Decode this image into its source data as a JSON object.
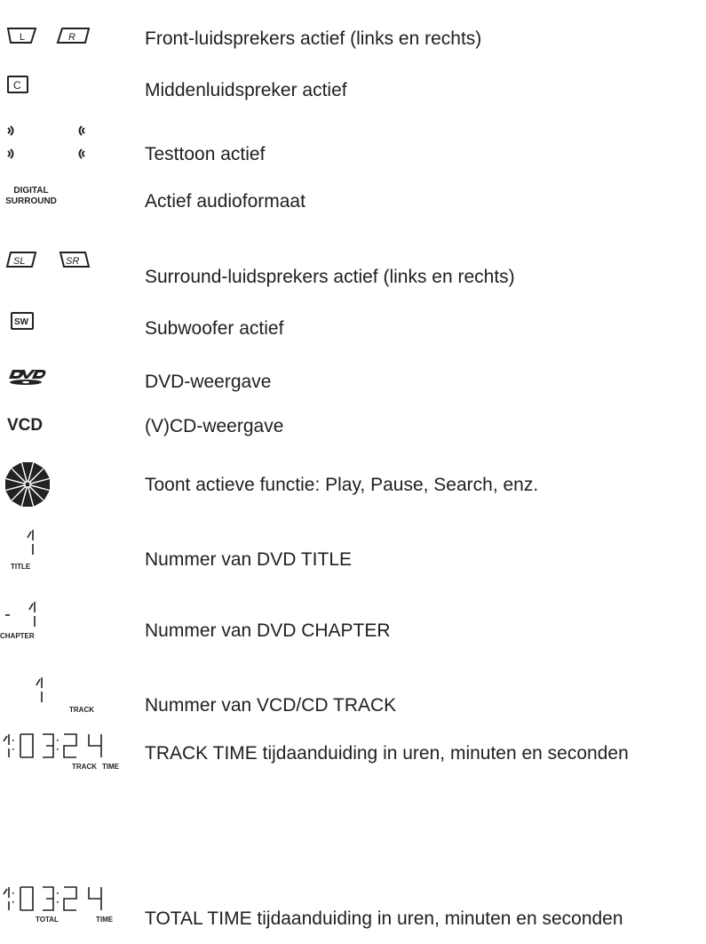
{
  "rows": [
    {
      "icon": "front-speakers-icon",
      "labels": [
        "L",
        "R"
      ],
      "text": "Front-luidsprekers actief (links en rechts)"
    },
    {
      "icon": "center-speaker-icon",
      "labels": [
        "C"
      ],
      "text": "Middenluidspreker actief"
    },
    {
      "icon": "test-tone-icon",
      "text": "Testtoon actief"
    },
    {
      "icon": "digital-surround-icon",
      "labels": [
        "DIGITAL",
        "SURROUND"
      ],
      "text": "Actief audioformaat"
    },
    {
      "icon": "surround-speakers-icon",
      "labels": [
        "SL",
        "SR"
      ],
      "text": "Surround-luidsprekers actief (links en rechts)"
    },
    {
      "icon": "subwoofer-icon",
      "labels": [
        "SW"
      ],
      "text": "Subwoofer actief"
    },
    {
      "icon": "dvd-logo-icon",
      "text": "DVD-weergave"
    },
    {
      "icon": "vcd-icon",
      "labels": [
        "VCD"
      ],
      "text": "(V)CD-weergave"
    },
    {
      "icon": "disc-wheel-icon",
      "text": "Toont actieve functie: Play, Pause, Search, enz."
    },
    {
      "icon": "title-number-icon",
      "labels": [
        "TITLE"
      ],
      "text": "Nummer van DVD TITLE"
    },
    {
      "icon": "chapter-number-icon",
      "labels": [
        "CHAPTER"
      ],
      "text": "Nummer van DVD CHAPTER"
    },
    {
      "icon": "track-number-icon",
      "labels": [
        "TRACK"
      ],
      "text": "Nummer van VCD/CD TRACK"
    },
    {
      "icon": "track-time-display-icon",
      "labels": [
        "TRACK",
        "TIME"
      ],
      "text": "TRACK TIME tijdaanduiding in uren, minuten en seconden"
    },
    {
      "icon": "total-time-display-icon",
      "labels": [
        "TOTAL",
        "TIME"
      ],
      "text": "TOTAL TIME tijdaanduiding in uren, minuten en seconden"
    }
  ]
}
